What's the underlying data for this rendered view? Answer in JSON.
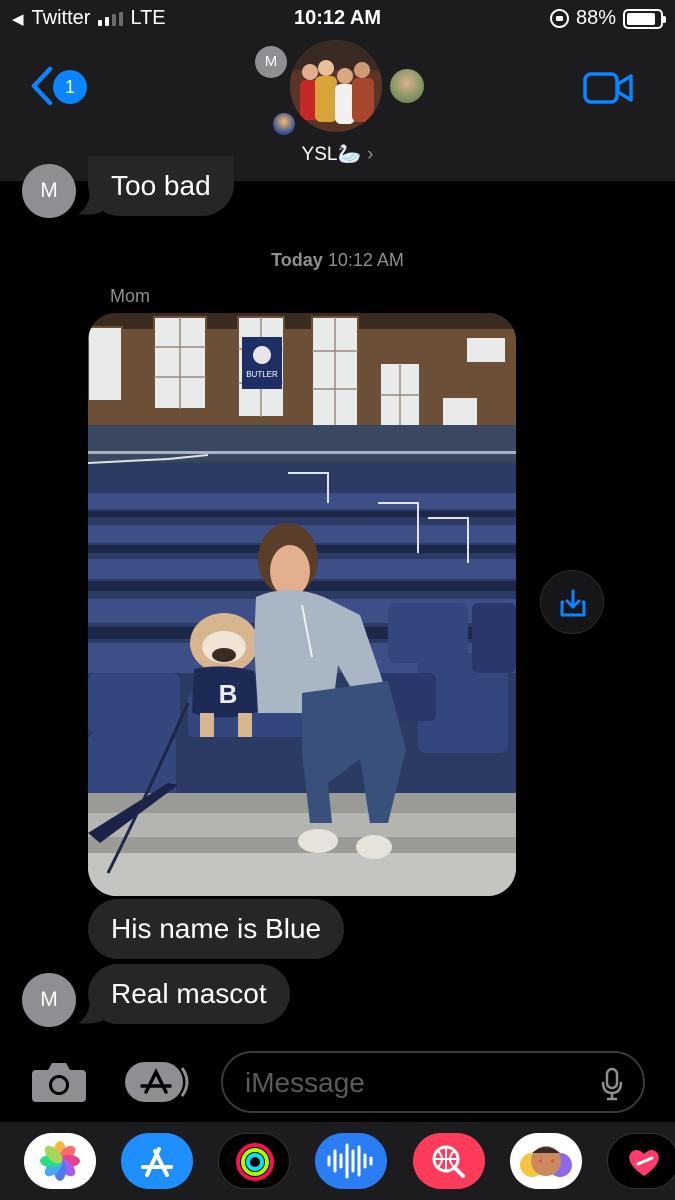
{
  "status_bar": {
    "back_app": "Twitter",
    "network": "LTE",
    "time": "10:12 AM",
    "battery": "88%",
    "battery_level": 0.88
  },
  "header": {
    "back_badge": "1",
    "group_name": "YSL🦢",
    "chevron": "›",
    "avatar_small_initial": "M"
  },
  "conversation": {
    "messages": [
      {
        "text": "Too bad"
      },
      {
        "text": "His name is Blue"
      },
      {
        "text": "Real mascot"
      }
    ],
    "timestamp_day": "Today",
    "timestamp_time": "10:12 AM",
    "sender_name": "Mom",
    "sender_initial": "M",
    "photo_banner_text": "BUTLER"
  },
  "compose": {
    "placeholder": "iMessage"
  },
  "app_drawer": {
    "apps": [
      "photos-icon",
      "app-store-icon",
      "activity-icon",
      "audio-message-icon",
      "search-images-icon",
      "memoji-icon",
      "digital-touch-icon"
    ]
  },
  "colors": {
    "accent": "#0a84ff",
    "bubble": "#262628",
    "header_bg": "#1c1c1e",
    "background": "#000000"
  }
}
